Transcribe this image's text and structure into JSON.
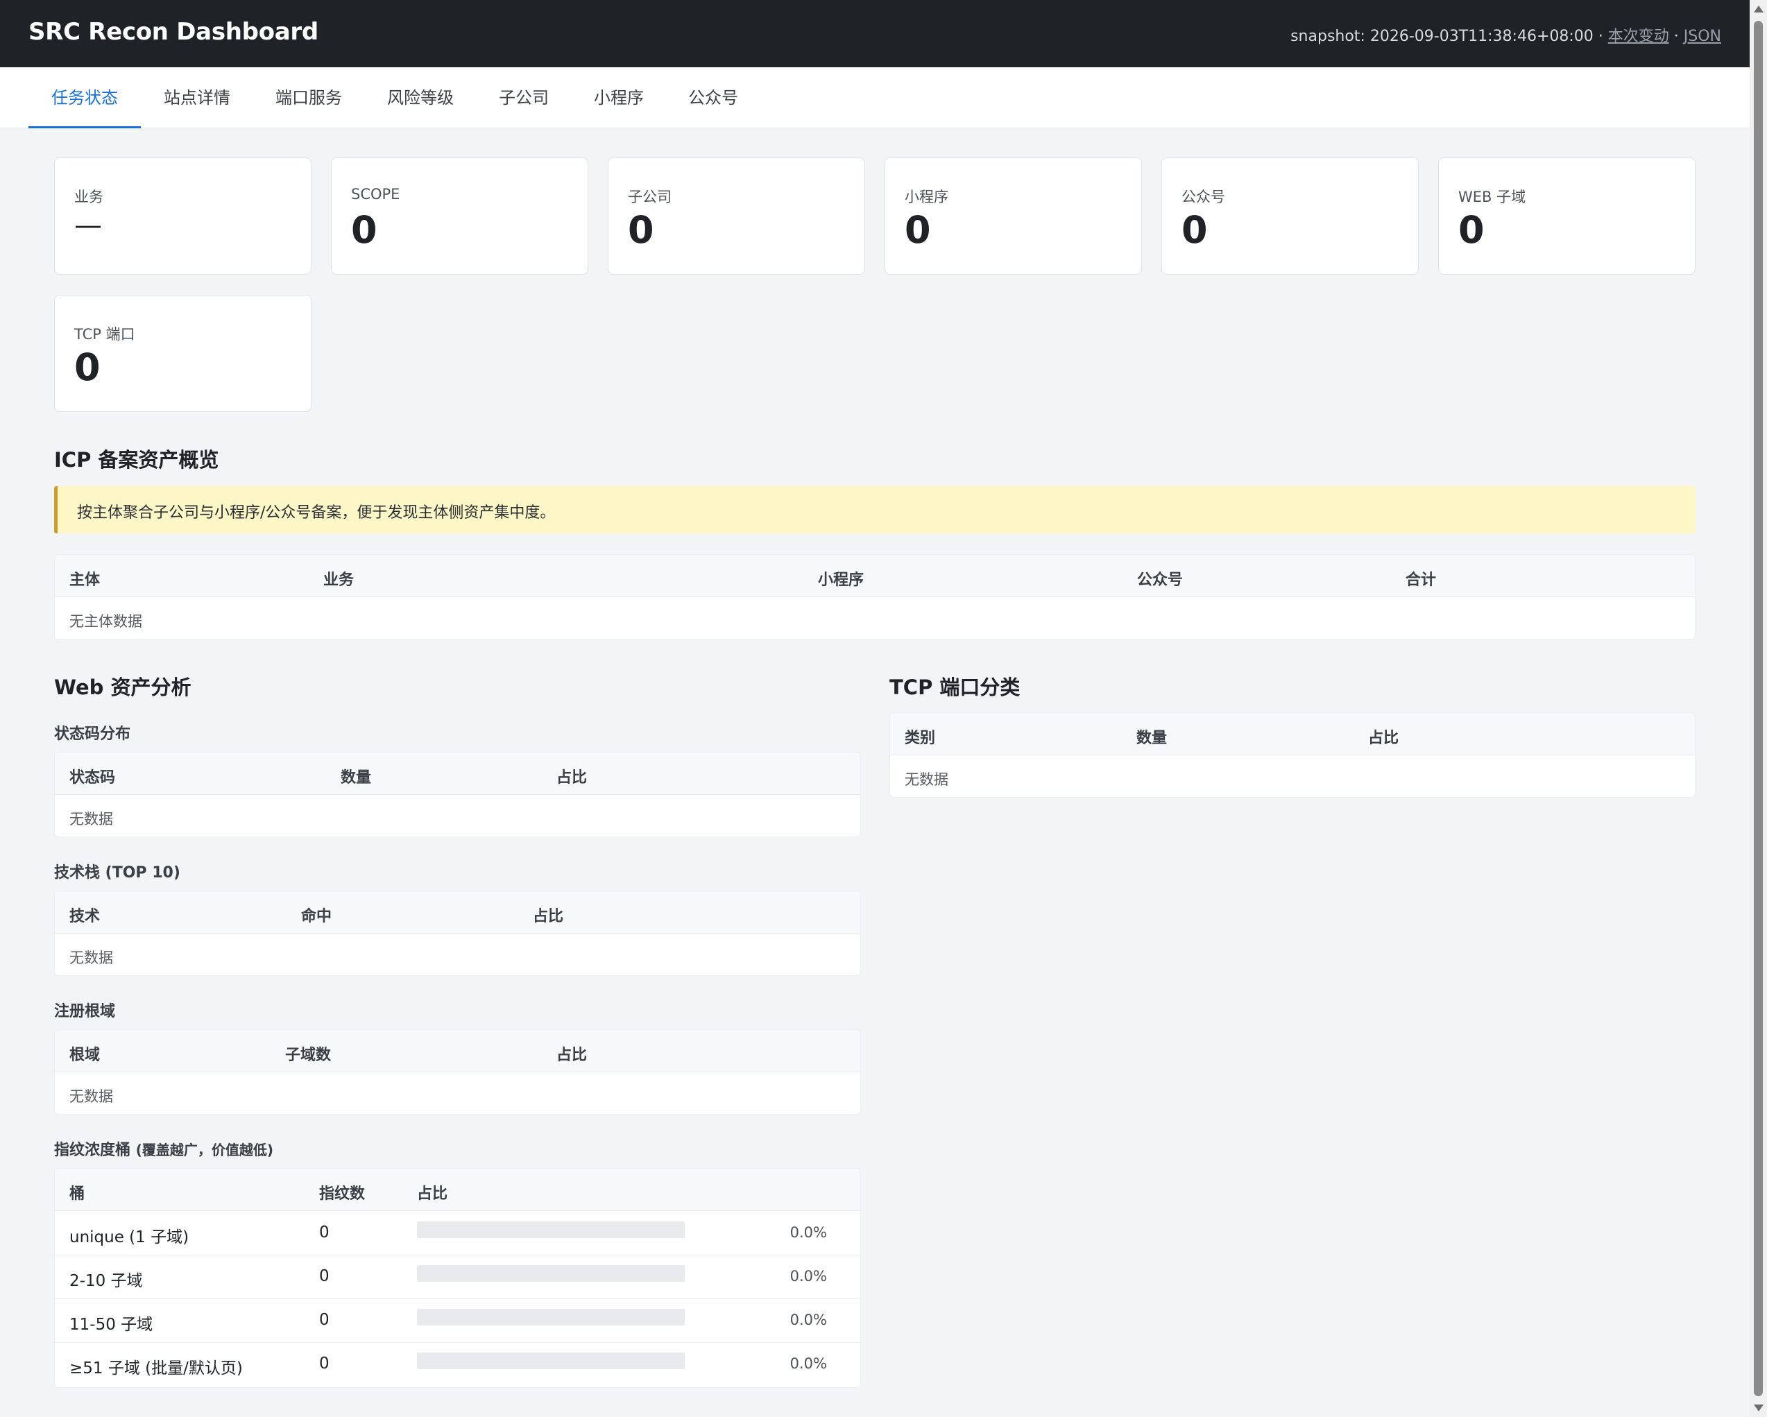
{
  "header": {
    "title": "SRC Recon Dashboard",
    "snapshot_text": "snapshot: 2026-09-03T11:38:46+08:00 · ",
    "changes_link": "本次变动",
    "separator": " · ",
    "json_link": "JSON"
  },
  "tabs": [
    {
      "label": "任务状态",
      "active": true
    },
    {
      "label": "站点详情",
      "active": false
    },
    {
      "label": "端口服务",
      "active": false
    },
    {
      "label": "风险等级",
      "active": false
    },
    {
      "label": "子公司",
      "active": false
    },
    {
      "label": "小程序",
      "active": false
    },
    {
      "label": "公众号",
      "active": false
    }
  ],
  "stats": [
    {
      "label": "业务",
      "value": "—"
    },
    {
      "label": "SCOPE",
      "value": "0"
    },
    {
      "label": "子公司",
      "value": "0"
    },
    {
      "label": "小程序",
      "value": "0"
    },
    {
      "label": "公众号",
      "value": "0"
    },
    {
      "label": "WEB 子域",
      "value": "0"
    },
    {
      "label": "TCP 端口",
      "value": "0"
    }
  ],
  "icp": {
    "title": "ICP 备案资产概览",
    "notice": "按主体聚合子公司与小程序/公众号备案，便于发现主体侧资产集中度。",
    "columns": [
      "主体",
      "业务",
      "小程序",
      "公众号",
      "合计"
    ],
    "empty": "无主体数据"
  },
  "web": {
    "title": "Web 资产分析",
    "status": {
      "title": "状态码分布",
      "columns": [
        "状态码",
        "数量",
        "占比"
      ],
      "empty": "无数据"
    },
    "tech": {
      "title": "技术栈 (TOP 10)",
      "columns": [
        "技术",
        "命中",
        "占比"
      ],
      "empty": "无数据"
    },
    "roots": {
      "title": "注册根域",
      "columns": [
        "根域",
        "子域数",
        "占比"
      ],
      "empty": "无数据"
    },
    "fingerprint": {
      "title": "指纹浓度桶",
      "subtitle": "(覆盖越广，价值越低)",
      "columns": [
        "桶",
        "指纹数",
        "占比"
      ],
      "rows": [
        {
          "bucket": "unique (1 子域)",
          "count": "0",
          "ratio": 0,
          "ratio_text": "0.0%"
        },
        {
          "bucket": "2-10 子域",
          "count": "0",
          "ratio": 0,
          "ratio_text": "0.0%"
        },
        {
          "bucket": "11-50 子域",
          "count": "0",
          "ratio": 0,
          "ratio_text": "0.0%"
        },
        {
          "bucket": "≥51 子域 (批量/默认页)",
          "count": "0",
          "ratio": 0,
          "ratio_text": "0.0%"
        }
      ]
    }
  },
  "tcp": {
    "title": "TCP 端口分类",
    "columns": [
      "类别",
      "数量",
      "占比"
    ],
    "empty": "无数据"
  },
  "colors": {
    "accent": "#1a6fd6",
    "topbar": "#1f2227",
    "notice_bg": "#fdf7c8",
    "notice_border": "#c8a032"
  }
}
